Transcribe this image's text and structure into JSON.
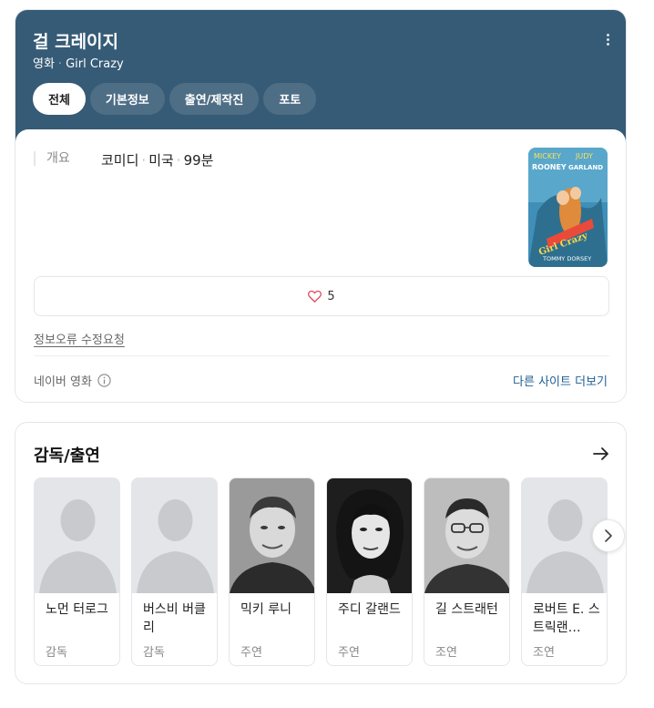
{
  "header": {
    "title": "걸 크레이지",
    "category": "영화",
    "original_title": "Girl Crazy",
    "tabs": [
      {
        "label": "전체",
        "active": true
      },
      {
        "label": "기본정보",
        "active": false
      },
      {
        "label": "출연/제작진",
        "active": false
      },
      {
        "label": "포토",
        "active": false
      }
    ]
  },
  "info": {
    "label": "개요",
    "genre": "코미디",
    "country": "미국",
    "runtime": "99분"
  },
  "poster": {
    "texts": [
      "MICKEY",
      "JUDY",
      "ROONEY",
      "GARLAND",
      "Girl Crazy",
      "TOMMY DORSEY"
    ]
  },
  "like": {
    "icon": "heart-icon",
    "count": "5"
  },
  "report_link": "정보오류 수정요청",
  "source": {
    "label": "네이버 영화",
    "info_icon": "info-icon"
  },
  "more_sites": "다른 사이트 더보기",
  "cast": {
    "heading": "감독/출연",
    "people": [
      {
        "name": "노먼 터로그",
        "role": "감독",
        "photo": "placeholder"
      },
      {
        "name": "버스비 버클리",
        "role": "감독",
        "photo": "placeholder"
      },
      {
        "name": "믹키 루니",
        "role": "주연",
        "photo": "portrait"
      },
      {
        "name": "주디 갈랜드",
        "role": "주연",
        "photo": "portrait"
      },
      {
        "name": "길 스트래턴",
        "role": "조연",
        "photo": "portrait"
      },
      {
        "name": "로버트 E. 스트릭랜…",
        "role": "조연",
        "photo": "placeholder"
      }
    ]
  },
  "colors": {
    "header_bg": "#365b76",
    "link": "#1f5f93",
    "heart": "#e0475a"
  }
}
